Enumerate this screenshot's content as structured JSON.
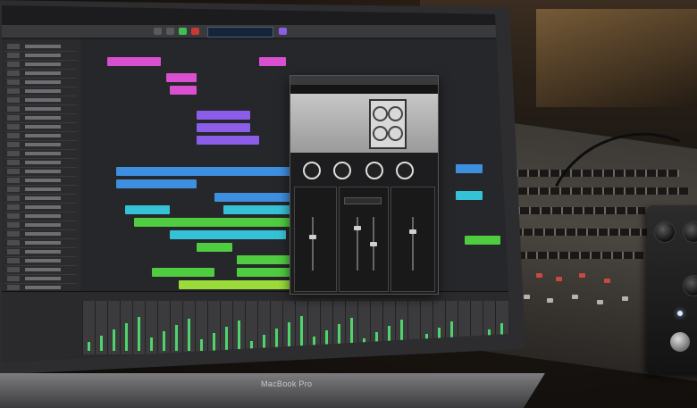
{
  "laptop": {
    "brand": "MacBook Pro"
  },
  "colors": {
    "region_pink": "#d84fcf",
    "region_purple": "#8b5de8",
    "region_blue": "#3f8fe0",
    "region_cyan": "#36c2d6",
    "region_green": "#4fcc3f",
    "region_lime": "#9bdc3a",
    "plugin_accent": "#b93a2b"
  },
  "icons": [
    "speaker-cabinet-icon",
    "play-icon",
    "record-icon",
    "knob-icon"
  ]
}
